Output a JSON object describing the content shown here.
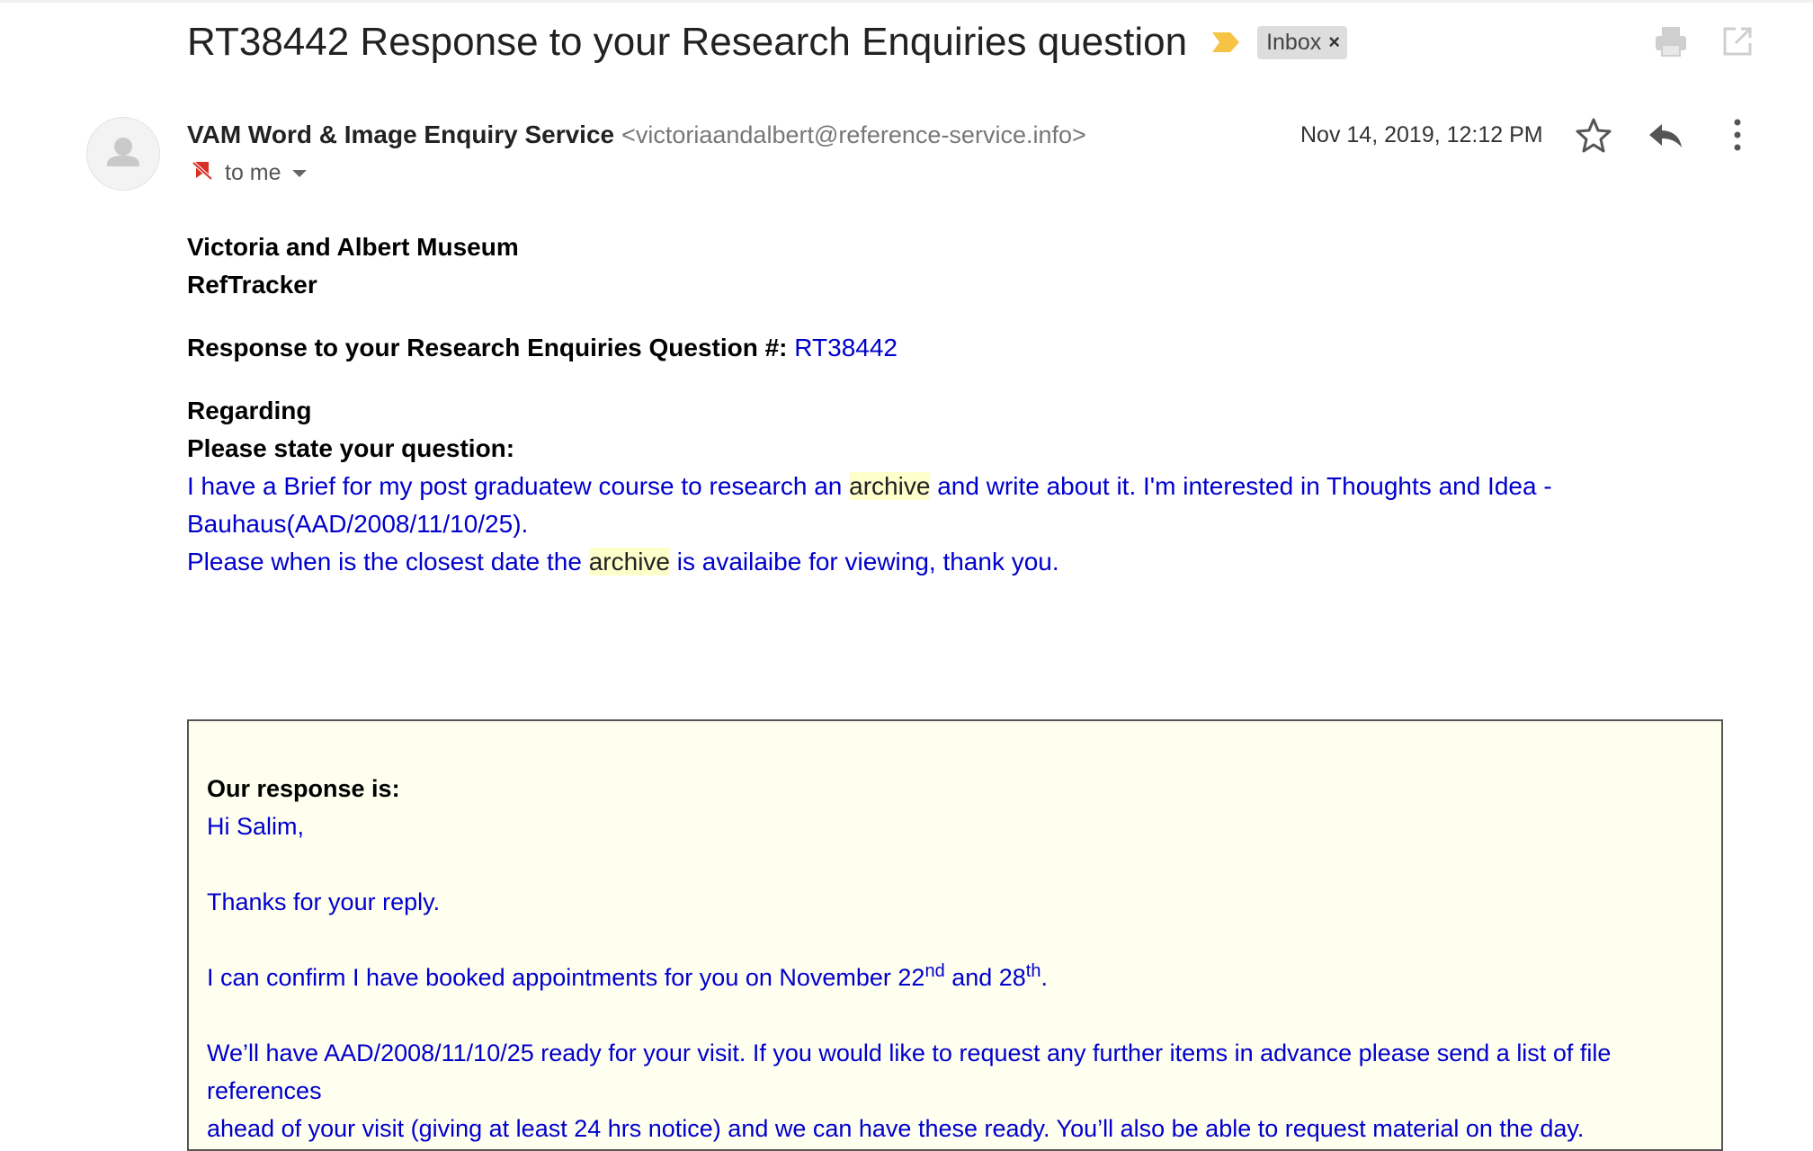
{
  "subject": {
    "title": "RT38442 Response to your Research Enquiries question",
    "label": "Inbox",
    "label_remove": "×",
    "importance_icon": "importance-marker",
    "importance_color": "#f6c344"
  },
  "toolbar": {
    "print_icon": "print-icon",
    "popout_icon": "open-in-new-window-icon"
  },
  "message": {
    "sender_name": "VAM Word & Image Enquiry Service",
    "sender_email": "<victoriaandalbert@reference-service.info>",
    "to": "to me",
    "date": "Nov 14, 2019, 12:12 PM",
    "actions": [
      "star-icon",
      "reply-icon",
      "more-options-icon"
    ]
  },
  "body": {
    "org_line1": "Victoria and Albert Museum",
    "org_line2": "RefTracker",
    "question_label": "Response to your Research Enquiries Question #:",
    "question_id": "RT38442",
    "regarding": "Regarding",
    "state_question": "Please state your question:",
    "q_part1": "I have a Brief for my post graduatew course to research an ",
    "q_highlight1": "archive",
    "q_part2": " and write about it. I'm interested in Thoughts and Idea -",
    "q_line2": "Bauhaus(AAD/2008/11/10/25).",
    "q_part3": "Please when is the closest date the ",
    "q_highlight2": "archive",
    "q_part4": " is availaibe for viewing, thank you."
  },
  "response": {
    "heading": "Our response is:",
    "greeting": "Hi Salim,",
    "thanks": "Thanks for your reply.",
    "confirm_a": "I can confirm I have booked appointments for you on November 22",
    "confirm_sup1": "nd",
    "confirm_b": " and 28",
    "confirm_sup2": "th",
    "confirm_c": ".",
    "ready_line1": "We’ll have AAD/2008/11/10/25 ready for your visit. If you would like to request any further items in advance please send a list of file references",
    "ready_line2": "ahead of your visit (giving at least 24 hrs notice) and we can have these ready. You’ll also be able to request material on the day."
  },
  "colors": {
    "link_blue": "#0000cc",
    "highlight": "#ffffcc",
    "response_bg": "#fffff0"
  }
}
